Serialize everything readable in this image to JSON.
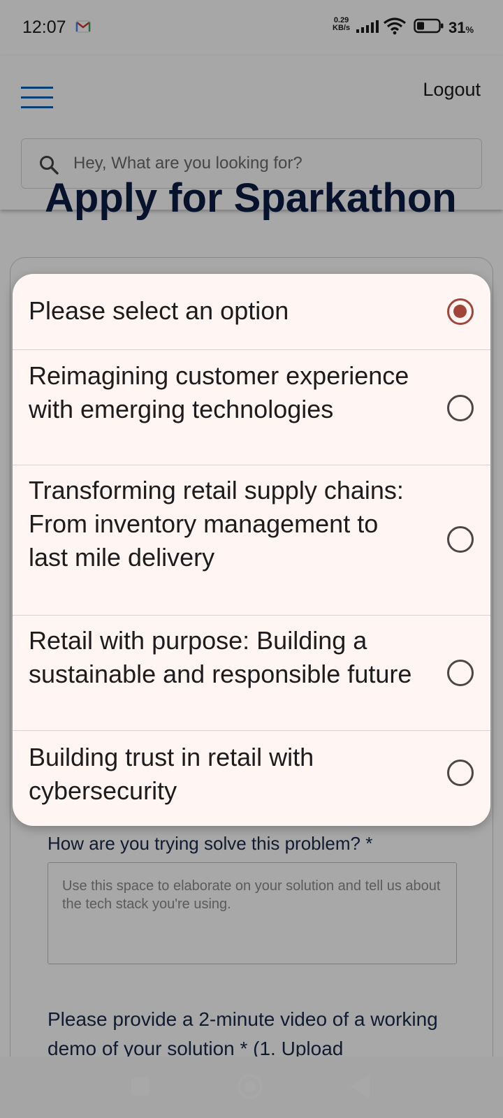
{
  "status_bar": {
    "time": "12:07",
    "net_speed_value": "0.29",
    "net_speed_unit": "KB/s",
    "battery_level": "31",
    "battery_unit": "%"
  },
  "header": {
    "logout_label": "Logout",
    "search_placeholder": "Hey, What are you looking for?"
  },
  "page": {
    "heading": "Apply for Sparkathon",
    "solution_question": "How are you trying solve this problem? *",
    "solution_placeholder": "Use this space to elaborate on your solution and tell us about the tech stack you're using.",
    "video_question": "Please provide a 2-minute video of a working demo of your solution * (1. Upload"
  },
  "dialog": {
    "options": [
      {
        "label": "Please select an option",
        "selected": true
      },
      {
        "label": "Reimagining customer experience with emerging technologies",
        "selected": false
      },
      {
        "label": "Transforming retail supply chains: From inventory management to last mile delivery",
        "selected": false
      },
      {
        "label": "Retail with purpose: Building a sustainable and responsible future",
        "selected": false
      },
      {
        "label": "Building trust in retail with cybersecurity",
        "selected": false
      }
    ]
  },
  "colors": {
    "accent_radio": "#a04538",
    "hamburger_blue": "#0a5fb4",
    "heading_navy": "#0b1e45",
    "dialog_bg": "#fff6f4"
  }
}
